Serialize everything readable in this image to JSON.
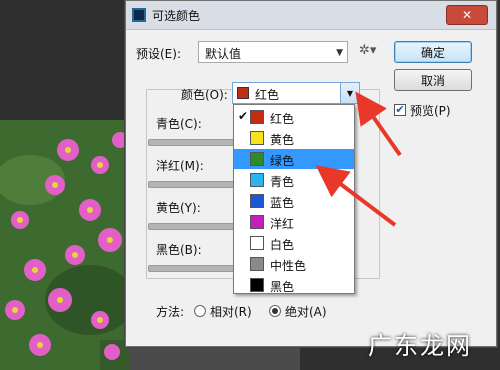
{
  "dialog": {
    "title": "可选颜色",
    "close_label": "✕",
    "preset_label": "预设(E):",
    "preset_value": "默认值",
    "ok_label": "确定",
    "cancel_label": "取消",
    "preview_label": "预览(P)",
    "preview_checked": true,
    "colors_label": "颜色(O):",
    "colors_value": "红色",
    "sliders": [
      {
        "label": "青色(C):"
      },
      {
        "label": "洋红(M):"
      },
      {
        "label": "黄色(Y):"
      },
      {
        "label": "黑色(B):"
      }
    ],
    "method_label": "方法:",
    "method_options": [
      "相对(R)",
      "绝对(A)"
    ],
    "method_selected": "绝对(A)"
  },
  "dropdown": {
    "items": [
      {
        "label": "红色",
        "color": "#c32e12",
        "checked": true
      },
      {
        "label": "黄色",
        "color": "#f7e21b"
      },
      {
        "label": "绿色",
        "color": "#2e8b26",
        "highlighted": true
      },
      {
        "label": "青色",
        "color": "#29b6f0"
      },
      {
        "label": "蓝色",
        "color": "#1c58d6"
      },
      {
        "label": "洋红",
        "color": "#c11fbe"
      },
      {
        "label": "白色",
        "color": "#ffffff"
      },
      {
        "label": "中性色",
        "color": "#8a8a8a"
      },
      {
        "label": "黑色",
        "color": "#000000"
      }
    ]
  },
  "watermark": "广东龙网"
}
